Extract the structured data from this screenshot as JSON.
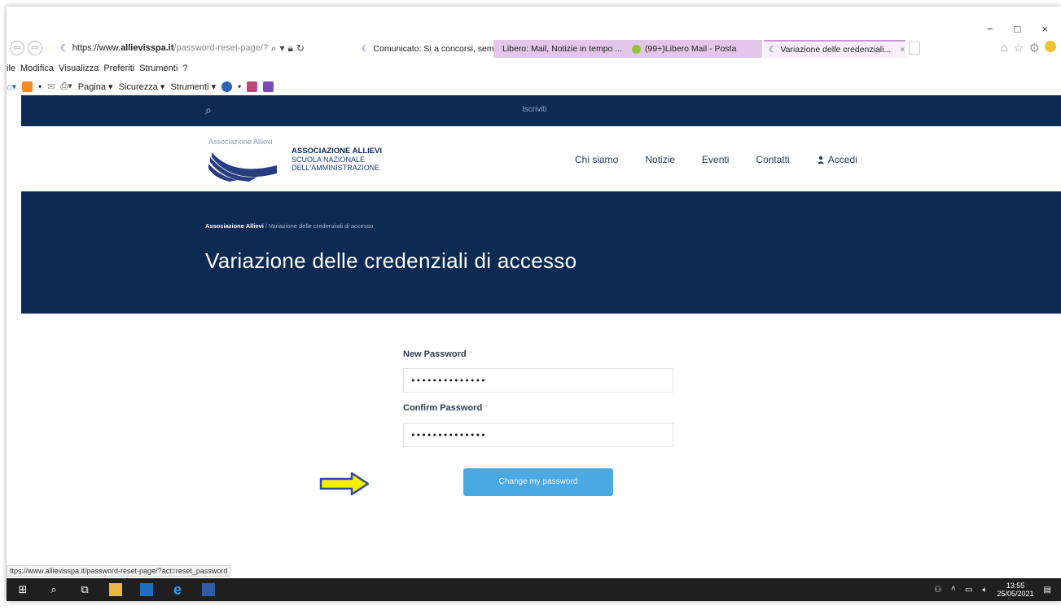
{
  "browser": {
    "window_controls": [
      "−",
      "□",
      "×"
    ],
    "address": {
      "url_prefix": "https://www.",
      "url_domain": "allievisspa.it",
      "url_path": "/password-reset-page/?act=reset_"
    },
    "tabs": [
      {
        "label": "Comunicato: Sì a concorsi, sem...",
        "style": "plain"
      },
      {
        "label": "Libero: Mail, Notizie in tempo ...",
        "style": "purple"
      },
      {
        "label": "(99+)Libero Mail - Posta",
        "style": "purple"
      },
      {
        "label": "Variazione delle credenziali...",
        "style": "active"
      }
    ],
    "menu": [
      "ile",
      "Modifica",
      "Visualizza",
      "Preferiti",
      "Strumenti",
      "?"
    ],
    "commands": [
      "Pagina ▾",
      "Sicurezza ▾",
      "Strumenti ▾"
    ]
  },
  "site": {
    "topbar": {
      "search_icon": "search-icon",
      "register_label": "Iscriviti"
    },
    "logo": {
      "top_text": "Associazione Allievi",
      "badge": "SNA"
    },
    "brand": {
      "line1": "ASSOCIAZIONE ALLIEVI",
      "line2": "SCUOLA NAZIONALE",
      "line3": "DELL'AMMINISTRAZIONE"
    },
    "nav": {
      "about": "Chi siamo",
      "news": "Notizie",
      "events": "Eventi",
      "contacts": "Contatti",
      "login": "Accedi"
    },
    "breadcrumb": {
      "home": "Associazione Allievi",
      "separator": " / ",
      "current": "Variazione delle credenziali di accesso"
    },
    "page_title": "Variazione delle credenziali di accesso"
  },
  "form": {
    "new_password_label": "New Password",
    "new_password_value": "••••••••••••••",
    "confirm_password_label": "Confirm Password",
    "confirm_password_value": "••••••••••••••",
    "required_mark": "*",
    "submit_label": "Change my password"
  },
  "status_bar": {
    "url": "ttps://www.allievisspa.it/password-reset-page/?act=reset_password"
  },
  "taskbar": {
    "time": "13:55",
    "date": "25/05/2021"
  },
  "colors": {
    "navy": "#0d2a52",
    "button": "#4aa9e2",
    "arrow_fill": "#f5f000",
    "arrow_stroke": "#2b4a9a"
  }
}
